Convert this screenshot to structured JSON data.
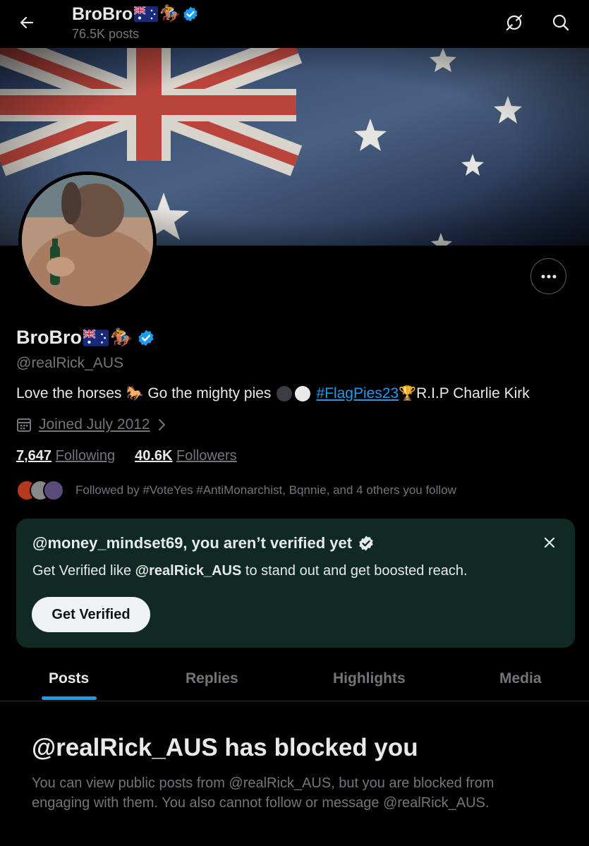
{
  "header": {
    "title": "BroBro",
    "posts_count": "76.5K posts"
  },
  "profile": {
    "name": "BroBro",
    "handle": "@realRick_AUS",
    "bio_prefix": "Love the horses",
    "bio_mid": "Go the mighty pies",
    "bio_hashtag": "#FlagPies23",
    "bio_suffix": "R.I.P Charlie Kirk",
    "joined": "Joined July 2012",
    "following_count": "7,647",
    "following_label": "Following",
    "followers_count": "40.6K",
    "followers_label": "Followers",
    "followed_by": "Followed by #VoteYes #AntiMonarchist, Bqnnie, and 4 others you follow"
  },
  "promo": {
    "title": "@money_mindset69, you aren’t verified yet",
    "text_prefix": "Get Verified like",
    "text_handle": "@realRick_AUS",
    "text_suffix": "to stand out and get boosted reach.",
    "button": "Get Verified"
  },
  "tabs": [
    {
      "label": "Posts"
    },
    {
      "label": "Replies"
    },
    {
      "label": "Highlights"
    },
    {
      "label": "Media"
    }
  ],
  "blocked": {
    "title": "@realRick_AUS has blocked you",
    "text": "You can view public posts from @realRick_AUS, but you are blocked from engaging with them. You also cannot follow or message @realRick_AUS."
  },
  "colors": {
    "accent": "#1d9bf0",
    "background": "#000000",
    "promo_bg": "#0f2a22"
  }
}
